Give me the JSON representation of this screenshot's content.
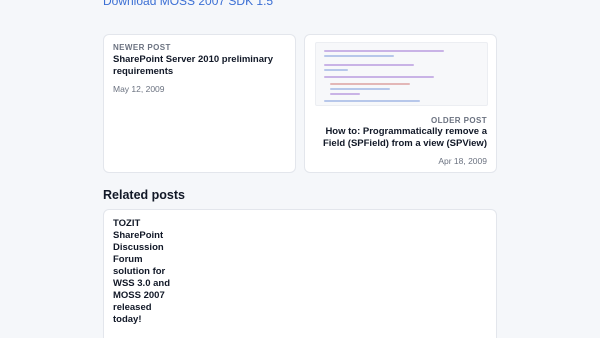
{
  "top_link": {
    "label": "Download MOSS 2007 SDK 1.5"
  },
  "newer_post": {
    "eyebrow": "NEWER POST",
    "title": "SharePoint Server 2010 preliminary requirements",
    "date": "May 12, 2009"
  },
  "older_post": {
    "eyebrow": "OLDER POST",
    "title": "How to: Programmatically remove a Field (SPField) from a view (SPView)",
    "date": "Apr 18, 2009",
    "thumbnail_icon": "code-screenshot-thumbnail"
  },
  "related": {
    "heading": "Related posts",
    "items": [
      {
        "title": "TOZIT SharePoint Discussion Forum solution for WSS 3.0 and MOSS 2007 released today!"
      }
    ]
  },
  "colors": {
    "link": "#3b6fd4",
    "background": "#f5f7fa",
    "card": "#ffffff",
    "muted_text": "#6b7280"
  }
}
